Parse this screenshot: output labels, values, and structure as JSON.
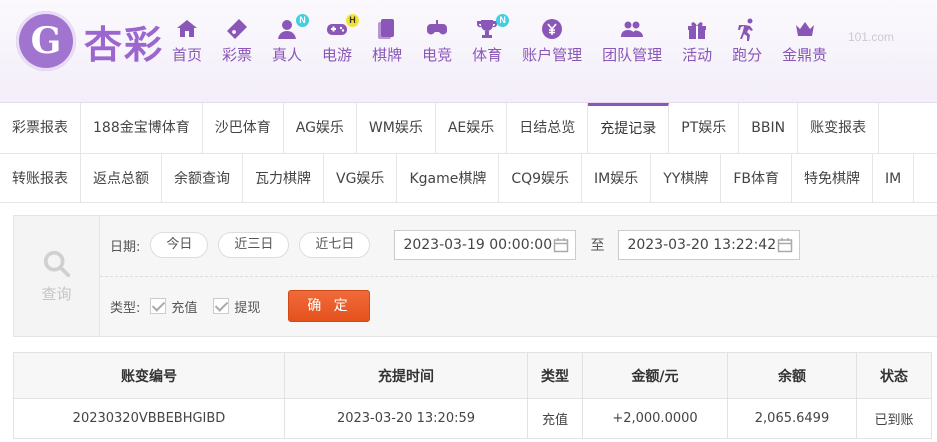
{
  "brand": {
    "logo_letter": "G",
    "name": "杏彩"
  },
  "watermark": "101.com",
  "nav": [
    {
      "label": "首页",
      "icon": "home-icon",
      "badge": ""
    },
    {
      "label": "彩票",
      "icon": "ticket-icon",
      "badge": ""
    },
    {
      "label": "真人",
      "icon": "dealer-icon",
      "badge": "N"
    },
    {
      "label": "电游",
      "icon": "gamepad-icon",
      "badge": "H"
    },
    {
      "label": "棋牌",
      "icon": "cards-icon",
      "badge": ""
    },
    {
      "label": "电竞",
      "icon": "esports-icon",
      "badge": ""
    },
    {
      "label": "体育",
      "icon": "trophy-icon",
      "badge": "N"
    },
    {
      "label": "账户管理",
      "icon": "yen-icon",
      "badge": ""
    },
    {
      "label": "团队管理",
      "icon": "team-icon",
      "badge": ""
    },
    {
      "label": "活动",
      "icon": "gift-icon",
      "badge": ""
    },
    {
      "label": "跑分",
      "icon": "run-icon",
      "badge": ""
    },
    {
      "label": "金鼎贵",
      "icon": "vip-icon",
      "badge": ""
    }
  ],
  "tabs_row1": [
    "彩票报表",
    "188金宝博体育",
    "沙巴体育",
    "AG娱乐",
    "WM娱乐",
    "AE娱乐",
    "日结总览",
    "充提记录",
    "PT娱乐",
    "BBIN",
    "账变报表"
  ],
  "tabs_row2": [
    "转账报表",
    "返点总额",
    "余额查询",
    "瓦力棋牌",
    "VG娱乐",
    "Kgame棋牌",
    "CQ9娱乐",
    "IM娱乐",
    "YY棋牌",
    "FB体育",
    "特免棋牌",
    "IM"
  ],
  "active_tab": "充提记录",
  "filter": {
    "query_label": "查询",
    "date_label": "日期:",
    "quick_ranges": [
      "今日",
      "近三日",
      "近七日"
    ],
    "start_date": "2023-03-19 00:00:00",
    "to_label": "至",
    "end_date": "2023-03-20 13:22:42",
    "type_label": "类型:",
    "types": [
      {
        "label": "充值",
        "checked": true
      },
      {
        "label": "提现",
        "checked": true
      }
    ],
    "confirm_label": "确 定"
  },
  "table": {
    "headers": [
      "账变编号",
      "充提时间",
      "类型",
      "金额/元",
      "余额",
      "状态"
    ],
    "rows": [
      {
        "id": "20230320VBBEBHGIBD",
        "time": "2023-03-20 13:20:59",
        "type": "充值",
        "amount": "+2,000.0000",
        "balance": "2,065.6499",
        "status": "已到账"
      }
    ]
  },
  "colors": {
    "brand": "#8a57b8",
    "accent_button": "#e95a27",
    "positive": "#d0021b",
    "success": "#2e9c1a"
  }
}
